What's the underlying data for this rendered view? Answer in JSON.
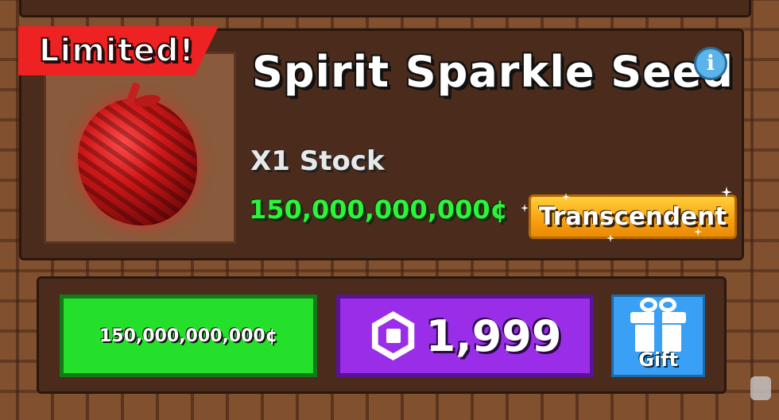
{
  "item": {
    "badge": "Limited!",
    "name": "Spirit Sparkle Seed",
    "info_icon": "i",
    "stock": "X1 Stock",
    "price": "150,000,000,000¢",
    "rarity": "Transcendent"
  },
  "purchase": {
    "money_button": "150,000,000,000¢",
    "robux_button": "1,999",
    "gift_button": "Gift"
  },
  "colors": {
    "price_green": "#2cf43a",
    "badge_red": "#ee2222",
    "rarity_gold": "#f8a010",
    "robux_purple": "#9a2ee8",
    "gift_blue": "#3aa0f5"
  },
  "icons": [
    "info-icon",
    "seed-image",
    "robux-icon",
    "gift-icon"
  ]
}
